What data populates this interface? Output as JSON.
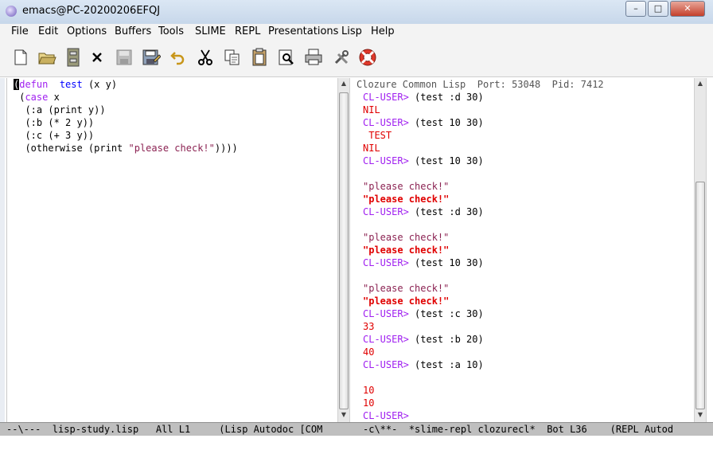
{
  "window": {
    "title": "emacs@PC-20200206EFQJ",
    "controls": {
      "minimize": "–",
      "maximize": "□",
      "close": "✕"
    }
  },
  "menu": [
    "File",
    "Edit",
    "Options",
    "Buffers",
    "Tools",
    "SLIME",
    "REPL",
    "Presentations",
    "Lisp",
    "Help"
  ],
  "toolbar_icons": [
    "new-file-icon",
    "open-folder-icon",
    "dired-icon",
    "close-buffer-icon",
    "save-icon",
    "save-as-icon",
    "undo-icon",
    "cut-icon",
    "copy-icon",
    "paste-icon",
    "search-icon",
    "print-icon",
    "customize-icon",
    "help-icon"
  ],
  "editor": {
    "lines": [
      [
        [
          "cur",
          "("
        ],
        [
          "kw",
          "defun"
        ],
        [
          "",
          "  "
        ],
        [
          "fn",
          "test"
        ],
        [
          "",
          " (x y)"
        ]
      ],
      [
        [
          "",
          " ("
        ],
        [
          "kw",
          "case"
        ],
        [
          "",
          " x"
        ]
      ],
      [
        [
          "",
          "  (:a (print y))"
        ]
      ],
      [
        [
          "",
          "  (:b (* 2 y))"
        ]
      ],
      [
        [
          "",
          "  (:c (+ 3 y))"
        ]
      ],
      [
        [
          "",
          "  (otherwise (print "
        ],
        [
          "str",
          "\"please check!\""
        ],
        [
          "",
          "))))"
        ]
      ]
    ]
  },
  "repl": {
    "header": "Clozure Common Lisp  Port: 53048  Pid: 7412",
    "lines": [
      [
        [
          "prompt",
          "CL-USER>"
        ],
        [
          "",
          " (test :d 30)"
        ]
      ],
      [
        [
          "out-red",
          "NIL"
        ]
      ],
      [
        [
          "prompt",
          "CL-USER>"
        ],
        [
          "",
          " (test 10 30)"
        ]
      ],
      [
        [
          "out-red",
          " TEST"
        ]
      ],
      [
        [
          "out-red",
          "NIL"
        ]
      ],
      [
        [
          "prompt",
          "CL-USER>"
        ],
        [
          "",
          " (test 10 30)"
        ]
      ],
      [
        [
          "",
          ""
        ]
      ],
      [
        [
          "str",
          "\"please check!\""
        ]
      ],
      [
        [
          "out-bold-red",
          "\"please check!\""
        ]
      ],
      [
        [
          "prompt",
          "CL-USER>"
        ],
        [
          "",
          " (test :d 30)"
        ]
      ],
      [
        [
          "",
          ""
        ]
      ],
      [
        [
          "str",
          "\"please check!\""
        ]
      ],
      [
        [
          "out-bold-red",
          "\"please check!\""
        ]
      ],
      [
        [
          "prompt",
          "CL-USER>"
        ],
        [
          "",
          " (test 10 30)"
        ]
      ],
      [
        [
          "",
          ""
        ]
      ],
      [
        [
          "str",
          "\"please check!\""
        ]
      ],
      [
        [
          "out-bold-red",
          "\"please check!\""
        ]
      ],
      [
        [
          "prompt",
          "CL-USER>"
        ],
        [
          "",
          " (test :c 30)"
        ]
      ],
      [
        [
          "out-red",
          "33"
        ]
      ],
      [
        [
          "prompt",
          "CL-USER>"
        ],
        [
          "",
          " (test :b 20)"
        ]
      ],
      [
        [
          "out-red",
          "40"
        ]
      ],
      [
        [
          "prompt",
          "CL-USER>"
        ],
        [
          "",
          " (test :a 10)"
        ]
      ],
      [
        [
          "",
          ""
        ]
      ],
      [
        [
          "out-red",
          "10"
        ]
      ],
      [
        [
          "out-red",
          "10"
        ]
      ],
      [
        [
          "prompt",
          "CL-USER>"
        ]
      ]
    ]
  },
  "modeline": {
    "left": "--\\---  lisp-study.lisp   All L1     (Lisp Autodoc [COM",
    "right": "-c\\**-  *slime-repl clozurecl*  Bot L36    (REPL Autod"
  },
  "colors": {
    "keyword": "#a020f0",
    "function": "#0000ff",
    "string": "#8b2252",
    "prompt": "#a020f0",
    "output": "#e00000"
  }
}
